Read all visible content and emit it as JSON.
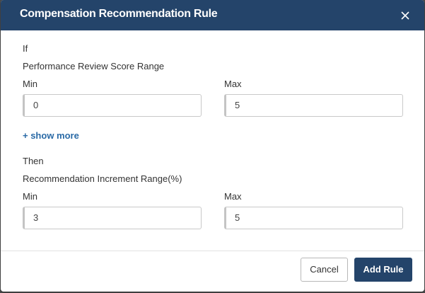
{
  "dialog": {
    "title": "Compensation Recommendation Rule",
    "close_icon": "close-icon"
  },
  "condition": {
    "label": "If",
    "range_title": "Performance Review Score Range",
    "min_label": "Min",
    "max_label": "Max",
    "min_value": "0",
    "max_value": "5",
    "show_more": "+ show more"
  },
  "result": {
    "label": "Then",
    "range_title": "Recommendation Increment Range(%)",
    "min_label": "Min",
    "max_label": "Max",
    "min_value": "3",
    "max_value": "5"
  },
  "footer": {
    "cancel_label": "Cancel",
    "add_label": "Add Rule"
  },
  "colors": {
    "header_bg": "#24446a",
    "primary_button": "#24446a",
    "link": "#2a6aa6"
  }
}
